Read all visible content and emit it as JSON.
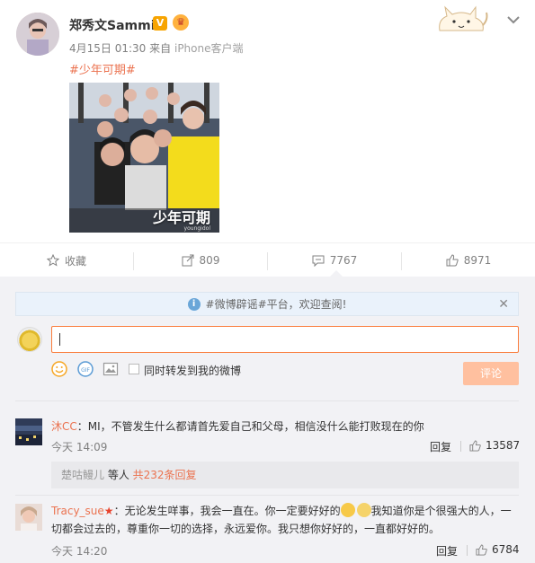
{
  "post": {
    "username": "郑秀文Sammi",
    "verified_badge": "V",
    "date": "4月15日 01:30",
    "from_label": "来自",
    "source": "iPhone客户端",
    "hashtag": "#少年可期#",
    "image_caption": "少年可期",
    "image_watermark": "youngidol"
  },
  "actions": {
    "favorite_label": "收藏",
    "share_count": "809",
    "comment_count": "7767",
    "like_count": "8971"
  },
  "notice": {
    "text": "#微博辟谣#平台，欢迎查阅!"
  },
  "composer": {
    "value": "",
    "repost_label": "同时转发到我的微博",
    "send_label": "评论"
  },
  "comments": [
    {
      "author": "沐CC",
      "text": "：MI，不管发生什么都请首先爱自己和父母，相信没什么能打败现在的你",
      "time": "今天 14:09",
      "reply_label": "回复",
      "likes": "13587",
      "sub_author": "楚咕鳗儿",
      "sub_mid": " 等人 ",
      "sub_more": "共232条回复"
    },
    {
      "author": "Tracy_sue",
      "text_a": "：无论发生咩事，我会一直在。你一定要好好的",
      "text_b": "我知道你是个很强大的人，一",
      "text_c": "切都会过去的，尊重你一切的选择，永远爱你。我只想你好好的，一直都好好的。",
      "time": "今天 14:20",
      "reply_label": "回复",
      "likes": "6784"
    }
  ],
  "colors": {
    "accent": "#eb7350",
    "send_disabled": "#ffc09f",
    "comment_bg": "#f2f2f5",
    "notice_bg": "#eaf2fb"
  }
}
